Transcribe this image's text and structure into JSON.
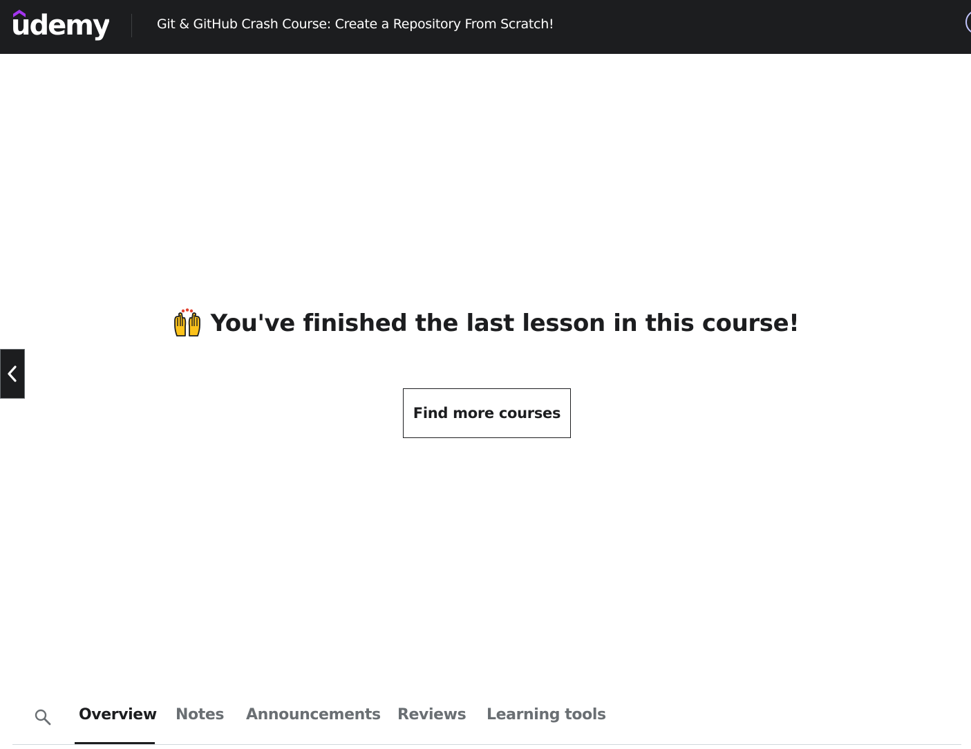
{
  "header": {
    "logo_text": "udemy",
    "course_title": "Git & GitHub Crash Course: Create a Repository From Scratch!",
    "brand_color": "#a435f0"
  },
  "main": {
    "finish_message": "You've finished the last lesson in this course!",
    "find_courses_label": "Find more courses",
    "prev_icon": "chevron-left-icon",
    "hands_icon": "raising-hands-icon"
  },
  "tabs": {
    "search_icon": "search-icon",
    "items": [
      {
        "label": "Overview",
        "active": true
      },
      {
        "label": "Notes",
        "active": false
      },
      {
        "label": "Announcements",
        "active": false
      },
      {
        "label": "Reviews",
        "active": false
      },
      {
        "label": "Learning tools",
        "active": false
      }
    ]
  },
  "colors": {
    "header_bg": "#1c1d1f",
    "text": "#1c1d1f",
    "muted": "#6a6f73"
  }
}
